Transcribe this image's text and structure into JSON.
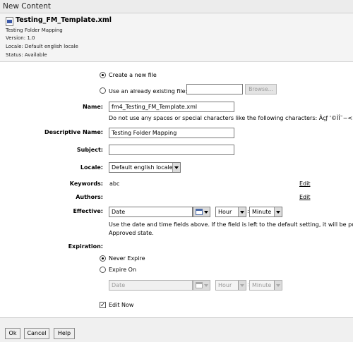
{
  "window": {
    "title": "New Content"
  },
  "header": {
    "file_name": "Testing_FM_Template.xml",
    "subtitle": "Testing Folder Mapping",
    "version": "Version: 1.0",
    "locale": "Locale: Default english locale",
    "status": "Status: Available"
  },
  "create_option": {
    "new_file_label": "Create a new file",
    "existing_file_label": "Use an already existing file:",
    "existing_file_value": "",
    "browse_label": "Browse..."
  },
  "form": {
    "name_label": "Name:",
    "name_value": "fm4_Testing_FM_Template.xml",
    "name_hint": "Do not use any spaces or special characters like the following characters: Âçƒ '©ÌÎ˜~<>",
    "descriptive_name_label": "Descriptive Name:",
    "descriptive_name_value": "Testing Folder Mapping",
    "subject_label": "Subject:",
    "subject_value": "",
    "locale_label": "Locale:",
    "locale_value": "Default english locale",
    "keywords_label": "Keywords:",
    "keywords_value": "abc",
    "edit_label": "Edit",
    "authors_label": "Authors:",
    "effective_label": "Effective:",
    "date_placeholder": "Date",
    "hour_value": "Hour",
    "minute_value": "Minute",
    "effective_hint_line1": "Use the date and time fields above. If the field is left to the default setting, it will be pu",
    "effective_hint_line2": "Approved state.",
    "expiration_label": "Expiration:",
    "never_expire_label": "Never Expire",
    "expire_on_label": "Expire On",
    "edit_now_label": "Edit Now"
  },
  "footer": {
    "ok": "Ok",
    "cancel": "Cancel",
    "help": "Help"
  }
}
